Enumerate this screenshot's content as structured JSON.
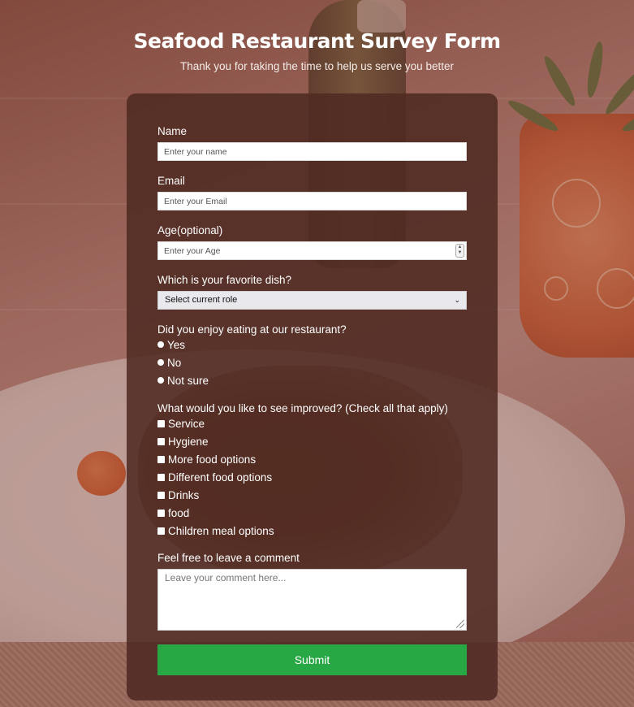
{
  "header": {
    "title": "Seafood Restaurant Survey Form",
    "subtitle": "Thank you for taking the time to help us serve you better"
  },
  "form": {
    "name": {
      "label": "Name",
      "placeholder": "Enter your name"
    },
    "email": {
      "label": "Email",
      "placeholder": "Enter your Email"
    },
    "age": {
      "label": "Age(optional)",
      "placeholder": "Enter your Age"
    },
    "dish": {
      "label": "Which is your favorite dish?",
      "selected": "Select current role"
    },
    "enjoy": {
      "label": "Did you enjoy eating at our restaurant?",
      "options": [
        "Yes",
        "No",
        "Not sure"
      ]
    },
    "improve": {
      "label": "What would you like to see improved? (Check all that apply)",
      "options": [
        "Service",
        "Hygiene",
        "More food options",
        "Different food options",
        "Drinks",
        "food",
        "Children meal options"
      ]
    },
    "comment": {
      "label": "Feel free to leave a comment",
      "placeholder": "Leave your comment here..."
    },
    "submit_label": "Submit"
  },
  "colors": {
    "accent_submit": "#28a745",
    "card": "#4e2a22"
  }
}
